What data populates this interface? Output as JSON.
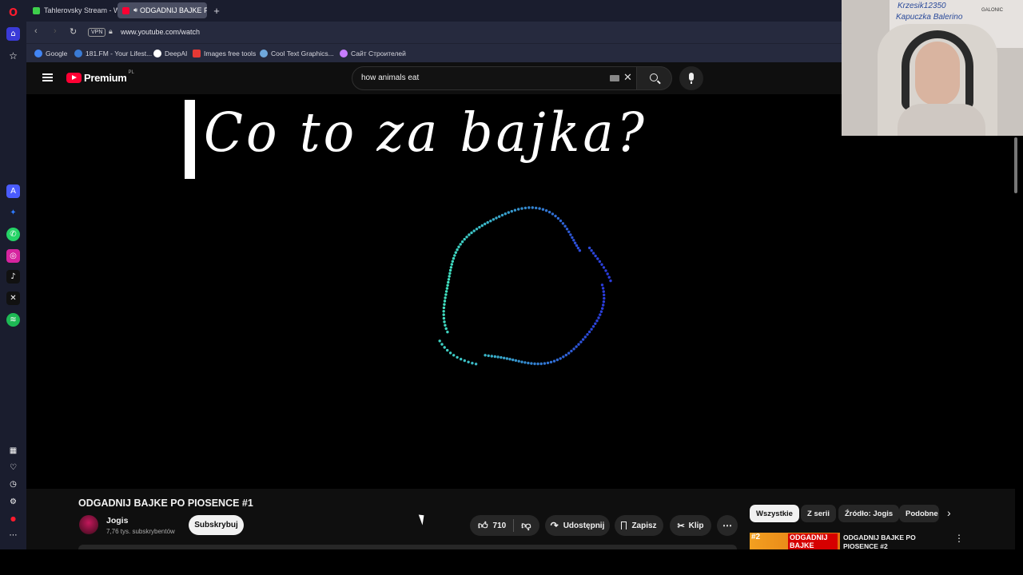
{
  "tabs": [
    {
      "title": "Tahlerovsky Stream - Wat",
      "favicon_color": "#3ecf4c"
    },
    {
      "title": "ODGADNIJ BAJKE PO",
      "favicon_color": "#ff0033",
      "active": true
    }
  ],
  "address": {
    "vpn_label": "VPN",
    "url": "www.youtube.com/watch"
  },
  "bookmarks": [
    {
      "label": "Google",
      "color": "#4285f4"
    },
    {
      "label": "181.FM - Your Lifest...",
      "color": "#3a7bd5"
    },
    {
      "label": "DeepAI",
      "color": "#ffffff"
    },
    {
      "label": "Images free tools",
      "color": "#e53935"
    },
    {
      "label": "Cool Text Graphics...",
      "color": "#6fa8dc"
    },
    {
      "label": "Сайт Строителей",
      "color": "#c77dff"
    }
  ],
  "youtube": {
    "logo_text": "Premium",
    "region": "PL",
    "search_value": "how animals eat"
  },
  "video": {
    "overlay_text": "Co to za bajka?",
    "title": "ODGADNIJ BAJKE PO PIOSENCE #1",
    "channel_name": "Jogis",
    "subscribers": "7,76 tys. subskrybentów",
    "subscribe_label": "Subskrybuj",
    "likes": "710",
    "share_label": "Udostępnij",
    "save_label": "Zapisz",
    "clip_label": "Klip"
  },
  "recommendations": {
    "chips": [
      "Wszystkie",
      "Z serii",
      "Źródło: Jogis",
      "Podobne"
    ],
    "first_title": "ODGADNIJ BAJKE PO PIOSENCE #2",
    "first_thumb_text": "ODGADNIJ BAJKE",
    "first_badge": "#2"
  },
  "webcam_board_text": [
    "Krzesik12350",
    "Kapuczka Balerino",
    "GALONIC"
  ],
  "colors": {
    "youtube_red": "#ff0033",
    "brand_sidebar": "#1a1d2e",
    "circle_start": "#40e0c0",
    "circle_end": "#2a3cdc"
  }
}
